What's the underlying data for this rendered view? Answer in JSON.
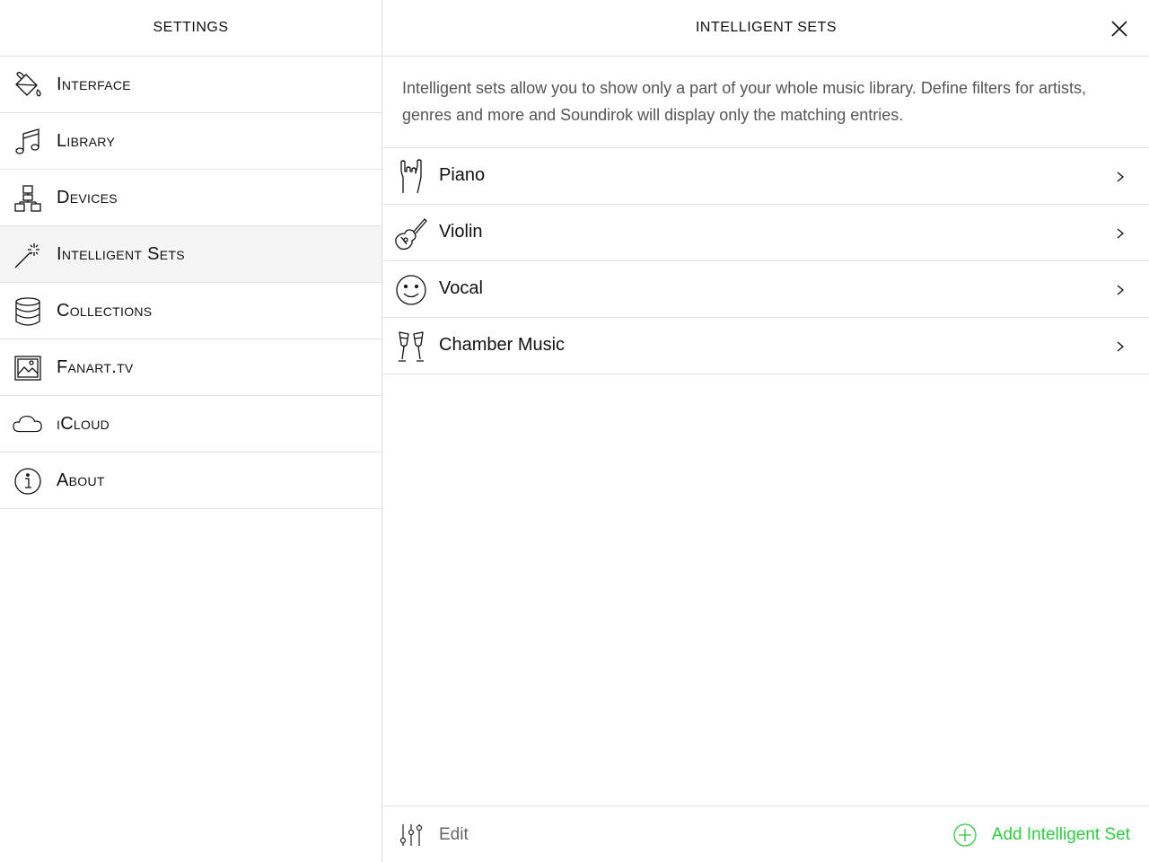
{
  "sidebar": {
    "title": "Settings",
    "items": [
      {
        "label": "Interface",
        "icon": "paint-bucket-icon",
        "active": false
      },
      {
        "label": "Library",
        "icon": "music-note-icon",
        "active": false
      },
      {
        "label": "Devices",
        "icon": "network-icon",
        "active": false
      },
      {
        "label": "Intelligent Sets",
        "icon": "magic-wand-icon",
        "active": true
      },
      {
        "label": "Collections",
        "icon": "database-icon",
        "active": false
      },
      {
        "label": "Fanart.tv",
        "icon": "image-icon",
        "active": false
      },
      {
        "label": "iCloud",
        "icon": "cloud-icon",
        "active": false
      },
      {
        "label": "About",
        "icon": "info-icon",
        "active": false
      }
    ]
  },
  "main": {
    "title": "Intelligent Sets",
    "description": "Intelligent sets allow you to show only a part of your whole music library. Define filters for artists, genres and more and Soundirok will display only the matching entries.",
    "sets": [
      {
        "label": "Piano",
        "icon": "rock-hand-icon"
      },
      {
        "label": "Violin",
        "icon": "guitar-icon"
      },
      {
        "label": "Vocal",
        "icon": "smiley-icon"
      },
      {
        "label": "Chamber Music",
        "icon": "champagne-glasses-icon"
      }
    ]
  },
  "footer": {
    "edit_label": "Edit",
    "add_label": "Add Intelligent Set"
  },
  "colors": {
    "accent": "#2ecc40",
    "active_row": "#f5f5f5",
    "divider": "#e2e2e2"
  }
}
